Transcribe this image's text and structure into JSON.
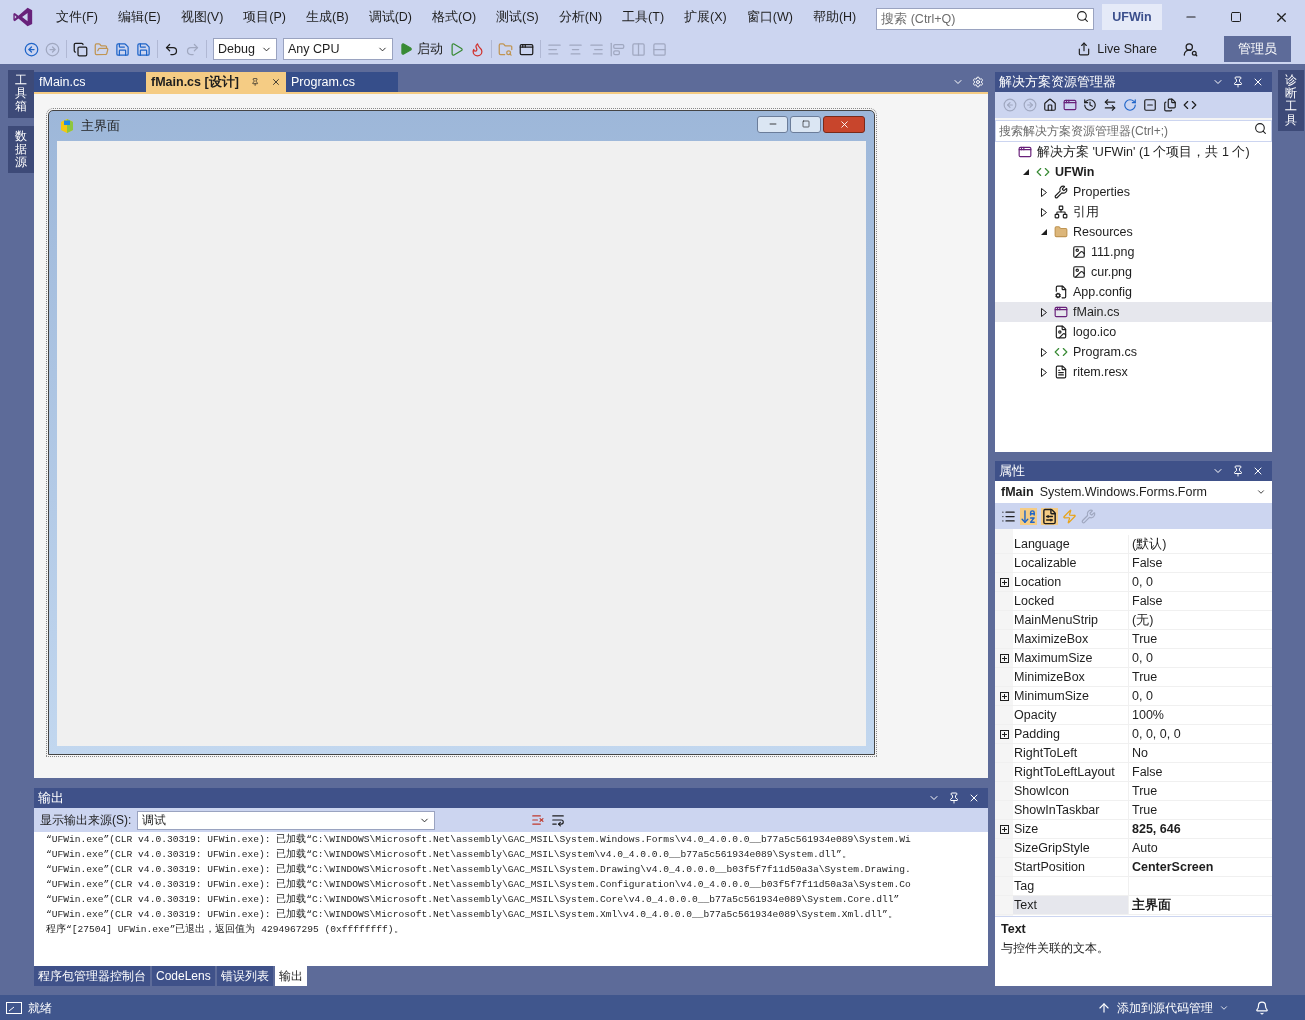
{
  "menu": [
    "文件(F)",
    "编辑(E)",
    "视图(V)",
    "项目(P)",
    "生成(B)",
    "调试(D)",
    "格式(O)",
    "测试(S)",
    "分析(N)",
    "工具(T)",
    "扩展(X)",
    "窗口(W)",
    "帮助(H)"
  ],
  "search": {
    "placeholder": "搜索 (Ctrl+Q)"
  },
  "solution_badge": "UFWin",
  "toolbar": {
    "configuration": "Debug",
    "platform": "Any CPU",
    "start": "启动",
    "live_share": "Live Share",
    "account": "管理员"
  },
  "left_tabs": [
    "工具箱",
    "数据源"
  ],
  "right_tabs": [
    "诊断工具"
  ],
  "doc_tabs": [
    {
      "label": "fMain.cs",
      "selected": false
    },
    {
      "label": "fMain.cs [设计]",
      "selected": true
    },
    {
      "label": "Program.cs",
      "selected": false
    }
  ],
  "form": {
    "title": "主界面"
  },
  "output": {
    "title": "输出",
    "source_label": "显示输出来源(S):",
    "source": "调试",
    "lines": [
      "“UFWin.exe”(CLR v4.0.30319: UFWin.exe): 已加载“C:\\WINDOWS\\Microsoft.Net\\assembly\\GAC_MSIL\\System.Windows.Forms\\v4.0_4.0.0.0__b77a5c561934e089\\System.Wi",
      "“UFWin.exe”(CLR v4.0.30319: UFWin.exe): 已加载“C:\\WINDOWS\\Microsoft.Net\\assembly\\GAC_MSIL\\System\\v4.0_4.0.0.0__b77a5c561934e089\\System.dll”。",
      "“UFWin.exe”(CLR v4.0.30319: UFWin.exe): 已加载“C:\\WINDOWS\\Microsoft.Net\\assembly\\GAC_MSIL\\System.Drawing\\v4.0_4.0.0.0__b03f5f7f11d50a3a\\System.Drawing.",
      "“UFWin.exe”(CLR v4.0.30319: UFWin.exe): 已加载“C:\\WINDOWS\\Microsoft.Net\\assembly\\GAC_MSIL\\System.Configuration\\v4.0_4.0.0.0__b03f5f7f11d50a3a\\System.Co",
      "“UFWin.exe”(CLR v4.0.30319: UFWin.exe): 已加载“C:\\WINDOWS\\Microsoft.Net\\assembly\\GAC_MSIL\\System.Core\\v4.0_4.0.0.0__b77a5c561934e089\\System.Core.dll”",
      "“UFWin.exe”(CLR v4.0.30319: UFWin.exe): 已加载“C:\\WINDOWS\\Microsoft.Net\\assembly\\GAC_MSIL\\System.Xml\\v4.0_4.0.0.0__b77a5c561934e089\\System.Xml.dll”。",
      "程序“[27504] UFWin.exe”已退出，返回值为 4294967295 (0xffffffff)。"
    ]
  },
  "bottom_tabs": [
    {
      "label": "程序包管理器控制台",
      "selected": false
    },
    {
      "label": "CodeLens",
      "selected": false
    },
    {
      "label": "错误列表",
      "selected": false
    },
    {
      "label": "输出",
      "selected": true
    }
  ],
  "solution_explorer": {
    "title": "解决方案资源管理器",
    "search_placeholder": "搜索解决方案资源管理器(Ctrl+;)",
    "tree": [
      {
        "label": "解决方案 'UFWin' (1 个项目，共 1 个)",
        "kind": "solution",
        "selected": false,
        "children": [
          {
            "label": "UFWin",
            "kind": "project",
            "expanded": true,
            "selected": false,
            "children": [
              {
                "label": "Properties",
                "kind": "properties",
                "expanded": false,
                "selected": false
              },
              {
                "label": "引用",
                "kind": "references",
                "expanded": false,
                "selected": false
              },
              {
                "label": "Resources",
                "kind": "folder",
                "expanded": true,
                "selected": false,
                "children": [
                  {
                    "label": "111.png",
                    "kind": "image",
                    "selected": false
                  },
                  {
                    "label": "cur.png",
                    "kind": "image",
                    "selected": false
                  }
                ]
              },
              {
                "label": "App.config",
                "kind": "config",
                "selected": false
              },
              {
                "label": "fMain.cs",
                "kind": "form",
                "expanded": false,
                "selected": true
              },
              {
                "label": "logo.ico",
                "kind": "icon",
                "selected": false
              },
              {
                "label": "Program.cs",
                "kind": "csharp",
                "expanded": false,
                "selected": false
              },
              {
                "label": "ritem.resx",
                "kind": "resx",
                "expanded": false,
                "selected": false
              }
            ]
          }
        ]
      }
    ]
  },
  "properties": {
    "title": "属性",
    "object_name": "fMain",
    "object_type": "System.Windows.Forms.Form",
    "rows": [
      {
        "name": "Language",
        "value": "(默认)",
        "expandable": false,
        "modified": false,
        "selected": false
      },
      {
        "name": "Localizable",
        "value": "False",
        "expandable": false,
        "modified": false,
        "selected": false
      },
      {
        "name": "Location",
        "value": "0, 0",
        "expandable": true,
        "modified": false,
        "selected": false
      },
      {
        "name": "Locked",
        "value": "False",
        "expandable": false,
        "modified": false,
        "selected": false
      },
      {
        "name": "MainMenuStrip",
        "value": "(无)",
        "expandable": false,
        "modified": false,
        "selected": false
      },
      {
        "name": "MaximizeBox",
        "value": "True",
        "expandable": false,
        "modified": false,
        "selected": false
      },
      {
        "name": "MaximumSize",
        "value": "0, 0",
        "expandable": true,
        "modified": false,
        "selected": false
      },
      {
        "name": "MinimizeBox",
        "value": "True",
        "expandable": false,
        "modified": false,
        "selected": false
      },
      {
        "name": "MinimumSize",
        "value": "0, 0",
        "expandable": true,
        "modified": false,
        "selected": false
      },
      {
        "name": "Opacity",
        "value": "100%",
        "expandable": false,
        "modified": false,
        "selected": false
      },
      {
        "name": "Padding",
        "value": "0, 0, 0, 0",
        "expandable": true,
        "modified": false,
        "selected": false
      },
      {
        "name": "RightToLeft",
        "value": "No",
        "expandable": false,
        "modified": false,
        "selected": false
      },
      {
        "name": "RightToLeftLayout",
        "value": "False",
        "expandable": false,
        "modified": false,
        "selected": false
      },
      {
        "name": "ShowIcon",
        "value": "True",
        "expandable": false,
        "modified": false,
        "selected": false
      },
      {
        "name": "ShowInTaskbar",
        "value": "True",
        "expandable": false,
        "modified": false,
        "selected": false
      },
      {
        "name": "Size",
        "value": "825, 646",
        "expandable": true,
        "modified": true,
        "selected": false
      },
      {
        "name": "SizeGripStyle",
        "value": "Auto",
        "expandable": false,
        "modified": false,
        "selected": false
      },
      {
        "name": "StartPosition",
        "value": "CenterScreen",
        "expandable": false,
        "modified": true,
        "selected": false
      },
      {
        "name": "Tag",
        "expandable": false,
        "selected": false
      },
      {
        "name": "Text",
        "value": "主界面",
        "expandable": false,
        "modified": true,
        "selected": true
      }
    ],
    "description_title": "Text",
    "description": "与控件关联的文本。"
  },
  "status": {
    "text": "就绪",
    "source_control": "添加到源代码管理"
  }
}
